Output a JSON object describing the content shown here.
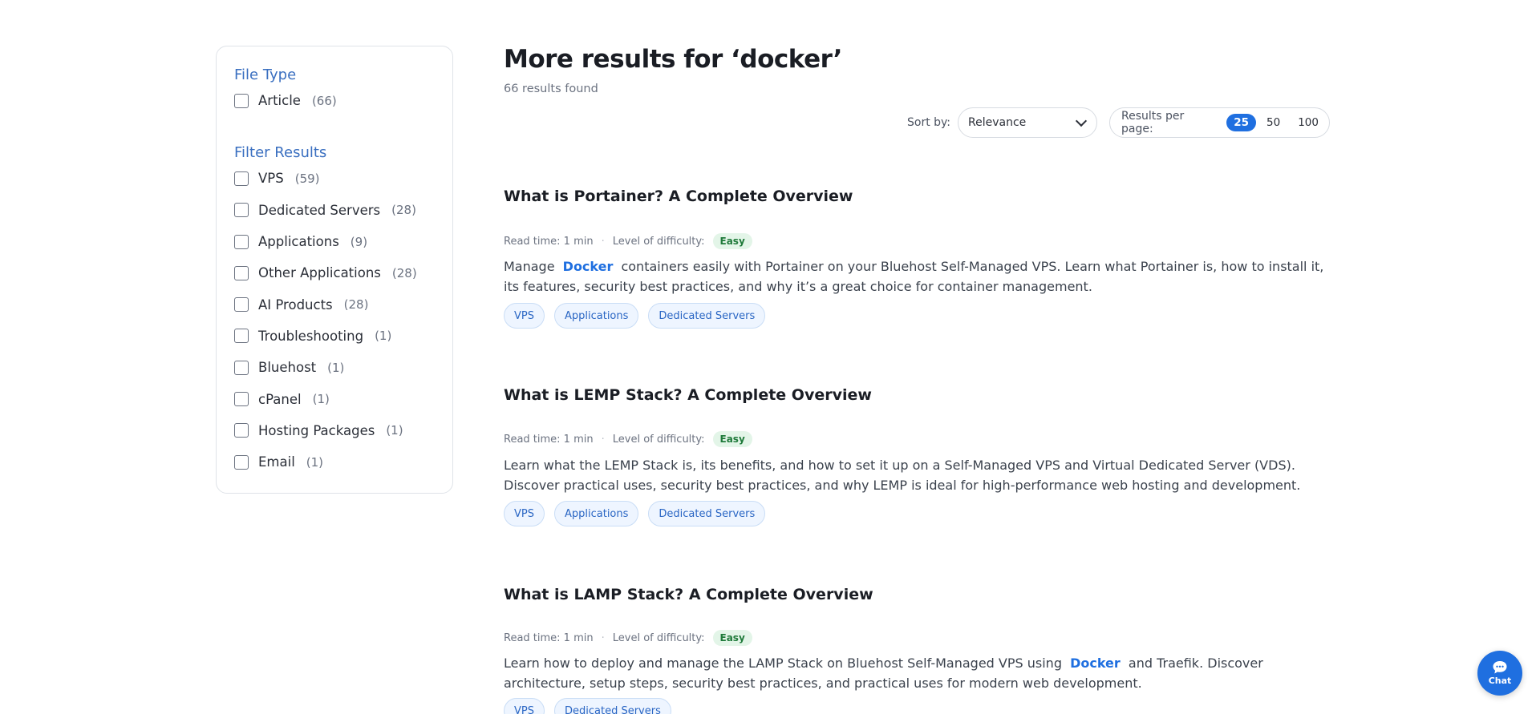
{
  "sidebar": {
    "file_type_title": "File Type",
    "file_types": [
      {
        "label": "Article",
        "count": "(66)"
      }
    ],
    "filter_title": "Filter Results",
    "filters": [
      {
        "label": "VPS",
        "count": "(59)"
      },
      {
        "label": "Dedicated Servers",
        "count": "(28)"
      },
      {
        "label": "Applications",
        "count": "(9)"
      },
      {
        "label": "Other Applications",
        "count": "(28)"
      },
      {
        "label": "AI Products",
        "count": "(28)"
      },
      {
        "label": "Troubleshooting",
        "count": "(1)"
      },
      {
        "label": "Bluehost",
        "count": "(1)"
      },
      {
        "label": "cPanel",
        "count": "(1)"
      },
      {
        "label": "Hosting Packages",
        "count": "(1)"
      },
      {
        "label": "Email",
        "count": "(1)"
      }
    ]
  },
  "header": {
    "title": "More results for ‘docker’",
    "results_count": "66 results found"
  },
  "controls": {
    "sort_label": "Sort by:",
    "sort_value": "Relevance",
    "per_page_label": "Results per page:",
    "per_page_options": [
      "25",
      "50",
      "100"
    ],
    "per_page_selected": "25"
  },
  "results": [
    {
      "title": "What is Portainer? A Complete Overview",
      "read_time": "Read time: 1 min",
      "difficulty_label": "Level of difficulty:",
      "difficulty": "Easy",
      "desc_before": "Manage",
      "desc_keyword": "Docker",
      "desc_after": "containers easily with Portainer on your Bluehost Self-Managed VPS. Learn what Portainer is, how to install it, its features, security best practices, and why it’s a great choice for container management.",
      "tags": [
        "VPS",
        "Applications",
        "Dedicated Servers"
      ]
    },
    {
      "title": "What is LEMP Stack? A Complete Overview",
      "read_time": "Read time: 1 min",
      "difficulty_label": "Level of difficulty:",
      "difficulty": "Easy",
      "desc_before": "Learn what the LEMP Stack is, its benefits, and how to set it up on a Self-Managed VPS and Virtual Dedicated Server (VDS). Discover practical uses, security best practices, and why LEMP is ideal for high-performance web hosting and development.",
      "desc_keyword": "",
      "desc_after": "",
      "tags": [
        "VPS",
        "Applications",
        "Dedicated Servers"
      ]
    },
    {
      "title": "What is LAMP Stack? A Complete Overview",
      "read_time": "Read time: 1 min",
      "difficulty_label": "Level of difficulty:",
      "difficulty": "Easy",
      "desc_before": "Learn how to deploy and manage the LAMP Stack on Bluehost Self-Managed VPS using",
      "desc_keyword": "Docker",
      "desc_after": "and Traefik. Discover architecture, setup steps, security best practices, and practical uses for modern web development.",
      "tags": [
        "VPS",
        "Dedicated Servers"
      ]
    }
  ],
  "chat": {
    "label": "Chat",
    "icon": "chat-bubble-icon",
    "color": "#1f6fe0"
  }
}
